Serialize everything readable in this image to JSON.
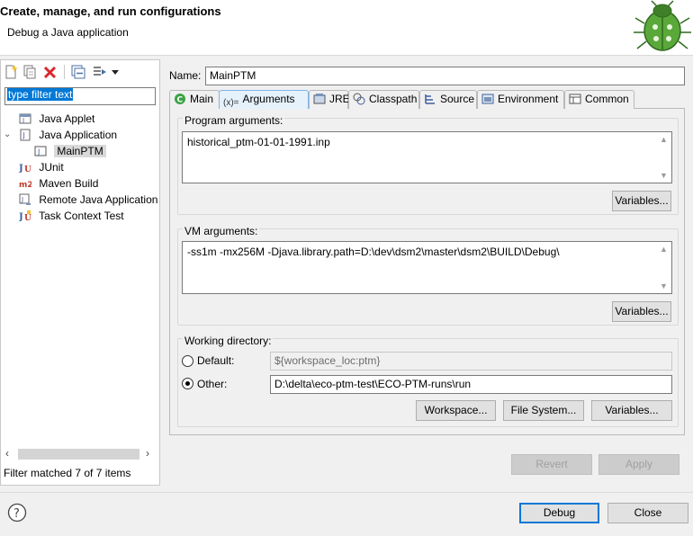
{
  "header": {
    "title": "Create, manage, and run configurations",
    "subtitle": "Debug a Java application",
    "logo_icon": "debug-bug-icon"
  },
  "left": {
    "toolbar_icons": [
      "new-configuration-icon",
      "duplicate-icon",
      "delete-icon",
      "collapse-all-icon",
      "filter-icon",
      "dropdown-arrow-icon"
    ],
    "filter_placeholder": "type filter text",
    "tree": [
      {
        "label": "Java Applet",
        "icon": "java-applet-icon"
      },
      {
        "label": "Java Application",
        "icon": "java-application-icon",
        "expanded": true
      },
      {
        "label": "MainPTM",
        "icon": "java-launch-icon",
        "selected": true
      },
      {
        "label": "JUnit",
        "icon": "junit-icon"
      },
      {
        "label": "Maven Build",
        "icon": "maven-icon"
      },
      {
        "label": "Remote Java Application",
        "icon": "remote-java-icon"
      },
      {
        "label": "Task Context Test",
        "icon": "task-context-icon"
      }
    ],
    "status": "Filter matched 7 of 7 items"
  },
  "config": {
    "name_label": "Name:",
    "name_value": "MainPTM",
    "tabs": [
      {
        "label": "Main",
        "icon": "main-icon"
      },
      {
        "label": "Arguments",
        "icon": "arguments-icon",
        "active": true
      },
      {
        "label": "JRE",
        "icon": "jre-icon"
      },
      {
        "label": "Classpath",
        "icon": "classpath-icon"
      },
      {
        "label": "Source",
        "icon": "source-icon"
      },
      {
        "label": "Environment",
        "icon": "environment-icon"
      },
      {
        "label": "Common",
        "icon": "common-icon"
      }
    ],
    "program_args_label": "Program arguments:",
    "program_args": "historical_ptm-01-01-1991.inp",
    "vm_args_label": "VM arguments:",
    "vm_args": "-ss1m -mx256M -Djava.library.path=D:\\dev\\dsm2\\master\\dsm2\\BUILD\\Debug\\",
    "variables_label": "Variables...",
    "working_dir_label": "Working directory:",
    "default_label": "Default:",
    "default_value": "${workspace_loc:ptm}",
    "other_label": "Other:",
    "other_value": "D:\\delta\\eco-ptm-test\\ECO-PTM-runs\\run",
    "workspace_label": "Workspace...",
    "filesystem_label": "File System...",
    "revert_label": "Revert",
    "apply_label": "Apply"
  },
  "footer": {
    "help_icon": "help-icon",
    "debug_label": "Debug",
    "close_label": "Close"
  },
  "colors": {
    "accent": "#0078d7",
    "selection": "#0078d7",
    "tab_active": "#e5f1fb"
  }
}
